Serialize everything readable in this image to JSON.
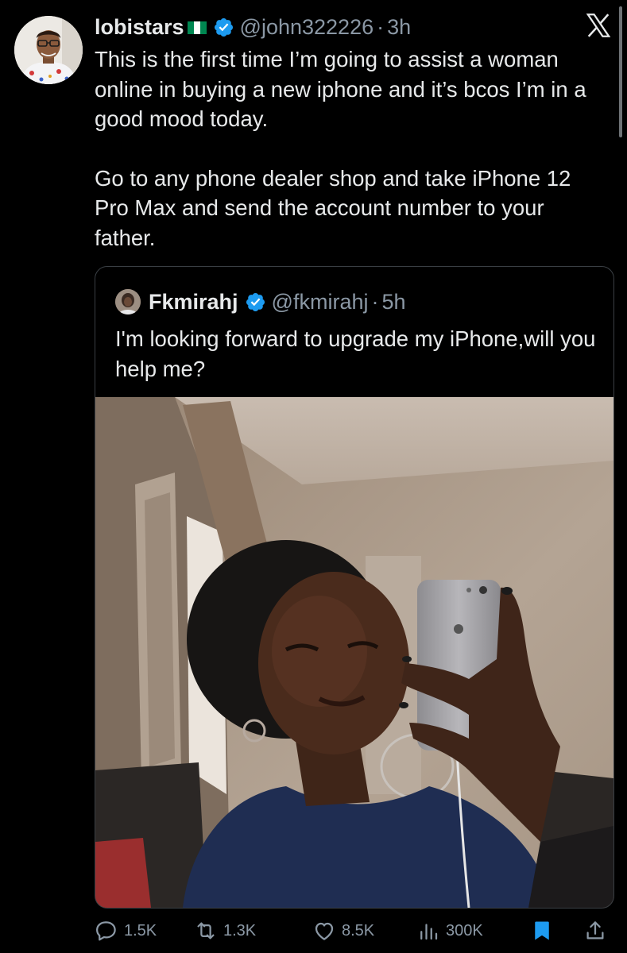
{
  "tweet": {
    "author": {
      "display_name": "lobistars",
      "flag_icon": "nigeria-flag-icon",
      "verified_icon": "verified-badge-icon",
      "handle": "@john322226",
      "separator": "·",
      "time": "3h"
    },
    "paragraphs": [
      "This is the first time I’m going to assist a woman online in buying a new iphone and it’s bcos I’m in a good mood today.",
      "Go to any phone dealer shop and take iPhone 12 Pro Max and send the account number to your father."
    ],
    "app_logo_icon": "x-logo-icon"
  },
  "quoted_tweet": {
    "author": {
      "display_name": "Fkmirahj",
      "verified_icon": "verified-badge-icon",
      "handle": "@fkmirahj",
      "separator": "·",
      "time": "5h"
    },
    "text": "I'm looking forward to upgrade my iPhone,will you help me?",
    "media_icon": "photo-icon"
  },
  "actions": {
    "reply": {
      "icon": "reply-icon",
      "count": "1.5K"
    },
    "retweet": {
      "icon": "retweet-icon",
      "count": "1.3K"
    },
    "like": {
      "icon": "heart-icon",
      "count": "8.5K"
    },
    "views": {
      "icon": "views-icon",
      "count": "300K"
    },
    "bookmark": {
      "icon": "bookmark-icon",
      "active": true
    },
    "share": {
      "icon": "share-icon"
    }
  },
  "colors": {
    "background": "#000000",
    "text": "#e7e9ea",
    "muted": "#8b98a5",
    "verified": "#1d9bf0",
    "bookmark_active": "#1d9bf0",
    "flag_green": "#008751"
  }
}
